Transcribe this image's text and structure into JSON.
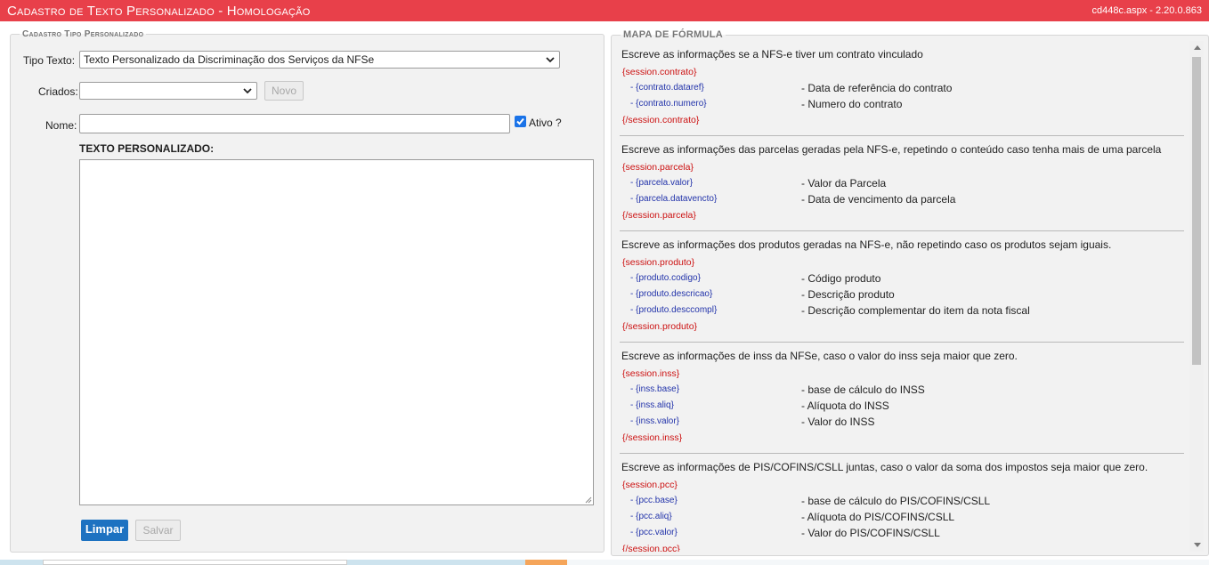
{
  "header": {
    "title": "Cadastro de Texto Personalizado  - Homologação",
    "version": "cd448c.aspx - 2.20.0.863",
    "color": "#e8404a"
  },
  "form": {
    "legend": "Cadastro Tipo Personalizado",
    "tipo_texto_label": "Tipo Texto:",
    "tipo_texto_value": "Texto Personalizado da Discriminação dos Serviços da NFSe",
    "criados_label": "Criados:",
    "criados_value": "",
    "novo_button": "Novo",
    "nome_label": "Nome:",
    "nome_value": "",
    "ativo_label": "Ativo ?",
    "ativo_checked": true,
    "texto_label": "TEXTO PERSONALIZADO:",
    "texto_value": "",
    "limpar_button": "Limpar",
    "salvar_button": "Salvar",
    "accent": "#1d72c1"
  },
  "map": {
    "legend": "MAPA DE FÓRMULA",
    "sections": [
      {
        "description": "Escreve as informações se a NFS-e tiver um contrato vinculado",
        "open_tag": "{session.contrato}",
        "items": [
          {
            "code": "- {contrato.dataref}",
            "meaning": "- Data de referência do contrato"
          },
          {
            "code": "- {contrato.numero}",
            "meaning": "- Numero do contrato"
          }
        ],
        "close_tag": "{/session.contrato}"
      },
      {
        "description": "Escreve as informações das parcelas geradas pela NFS-e, repetindo o conteúdo caso tenha mais de uma parcela",
        "open_tag": "{session.parcela}",
        "items": [
          {
            "code": "- {parcela.valor}",
            "meaning": "- Valor da Parcela"
          },
          {
            "code": "- {parcela.datavencto}",
            "meaning": "- Data de vencimento da parcela"
          }
        ],
        "close_tag": "{/session.parcela}"
      },
      {
        "description": "Escreve as informações dos produtos geradas na NFS-e, não repetindo caso os produtos sejam iguais.",
        "open_tag": "{session.produto}",
        "items": [
          {
            "code": "- {produto.codigo}",
            "meaning": "- Código produto"
          },
          {
            "code": "- {produto.descricao}",
            "meaning": "- Descrição produto"
          },
          {
            "code": "- {produto.desccompl}",
            "meaning": "- Descrição complementar do item da nota fiscal"
          }
        ],
        "close_tag": "{/session.produto}"
      },
      {
        "description": "Escreve as informações de inss da NFSe, caso o valor do inss seja maior que zero.",
        "open_tag": "{session.inss}",
        "items": [
          {
            "code": "- {inss.base}",
            "meaning": "- base de cálculo do INSS"
          },
          {
            "code": "- {inss.aliq}",
            "meaning": "- Alíquota do INSS"
          },
          {
            "code": "- {inss.valor}",
            "meaning": "- Valor do INSS"
          }
        ],
        "close_tag": "{/session.inss}"
      },
      {
        "description": "Escreve as informações de PIS/COFINS/CSLL juntas, caso o valor da soma dos impostos seja maior que zero.",
        "open_tag": "{session.pcc}",
        "items": [
          {
            "code": "- {pcc.base}",
            "meaning": "- base de cálculo do PIS/COFINS/CSLL"
          },
          {
            "code": "- {pcc.aliq}",
            "meaning": "- Alíquota do PIS/COFINS/CSLL"
          },
          {
            "code": "- {pcc.valor}",
            "meaning": "- Valor do PIS/COFINS/CSLL"
          }
        ],
        "close_tag": "{/session.pcc}"
      }
    ]
  }
}
